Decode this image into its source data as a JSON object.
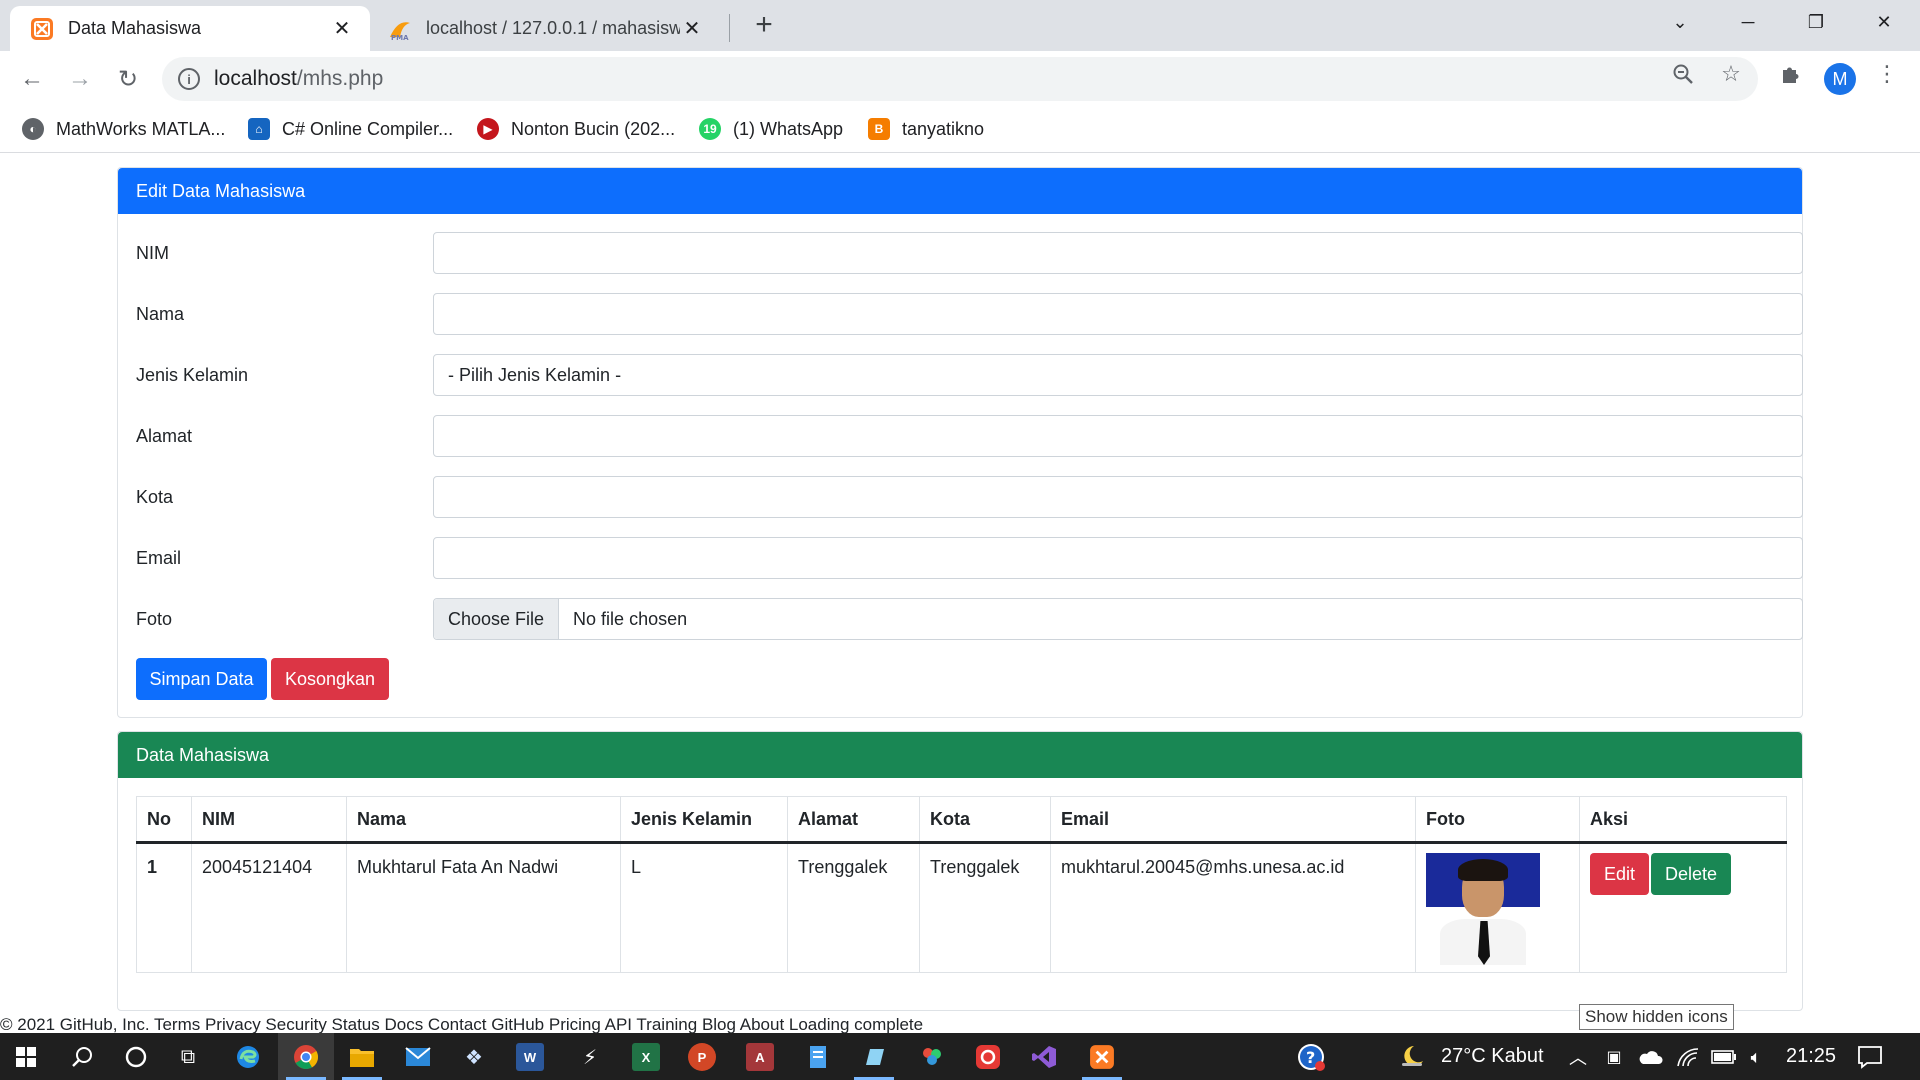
{
  "browser": {
    "tabs": [
      {
        "title": "Data Mahasiswa",
        "active": true
      },
      {
        "title": "localhost / 127.0.0.1 / mahasiswa",
        "active": false
      }
    ],
    "url_host": "localhost",
    "url_path": "/mhs.php",
    "profile_initial": "M",
    "bookmarks": [
      {
        "label": "MathWorks MATLA...",
        "icon": "globe-icon"
      },
      {
        "label": "C# Online Compiler...",
        "icon": "compiler-icon"
      },
      {
        "label": "Nonton Bucin (202...",
        "icon": "play-icon"
      },
      {
        "label": "(1) WhatsApp",
        "icon": "whatsapp-icon",
        "badge": "19"
      },
      {
        "label": "tanyatikno",
        "icon": "blogger-icon"
      }
    ]
  },
  "form": {
    "header": "Edit Data Mahasiswa",
    "fields": [
      {
        "label": "NIM",
        "value": ""
      },
      {
        "label": "Nama",
        "value": ""
      },
      {
        "label": "Jenis Kelamin",
        "value": "- Pilih Jenis Kelamin -"
      },
      {
        "label": "Alamat",
        "value": ""
      },
      {
        "label": "Kota",
        "value": ""
      },
      {
        "label": "Email",
        "value": ""
      },
      {
        "label": "Foto",
        "choose_label": "Choose File",
        "file_status": "No file chosen"
      }
    ],
    "save_label": "Simpan Data",
    "clear_label": "Kosongkan"
  },
  "table": {
    "header": "Data Mahasiswa",
    "columns": [
      "No",
      "NIM",
      "Nama",
      "Jenis Kelamin",
      "Alamat",
      "Kota",
      "Email",
      "Foto",
      "Aksi"
    ],
    "rows": [
      {
        "no": "1",
        "nim": "20045121404",
        "nama": "Mukhtarul Fata An Nadwi",
        "jk": "L",
        "alamat": "Trenggalek",
        "kota": "Trenggalek",
        "email": "mukhtarul.20045@mhs.unesa.ac.id",
        "edit_label": "Edit",
        "delete_label": "Delete"
      }
    ]
  },
  "footer": "© 2021 GitHub, Inc. Terms Privacy Security Status Docs Contact GitHub Pricing API Training Blog About Loading complete",
  "tooltip": "Show hidden icons",
  "taskbar": {
    "weather": "27°C  Kabut",
    "time": "21:25"
  },
  "colors": {
    "primary": "#0d6efd",
    "danger": "#dc3545",
    "success": "#198754"
  }
}
